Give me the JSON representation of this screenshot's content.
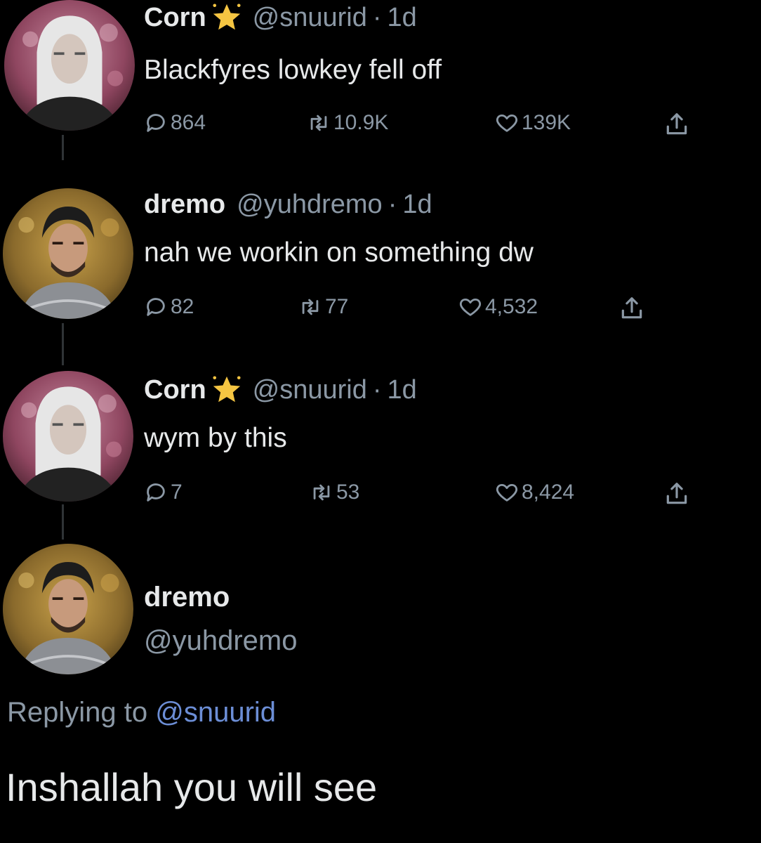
{
  "tweets": [
    {
      "display_name": "Corn",
      "handle": "@snuurid",
      "separator": "·",
      "time": "1d",
      "text": "Blackfyres lowkey fell off",
      "replies": "864",
      "retweets": "10.9K",
      "likes": "139K"
    },
    {
      "display_name": "dremo",
      "handle": "@yuhdremo",
      "separator": "·",
      "time": "1d",
      "text": "nah we workin on something dw",
      "replies": "82",
      "retweets": "77",
      "likes": "4,532"
    },
    {
      "display_name": "Corn",
      "handle": "@snuurid",
      "separator": "·",
      "time": "1d",
      "text": "wym by this",
      "replies": "7",
      "retweets": "53",
      "likes": "8,424"
    }
  ],
  "final_tweet": {
    "display_name": "dremo",
    "handle": "@yuhdremo",
    "replying_prefix": "Replying to",
    "replying_to": "@snuurid",
    "text": "Inshallah you will see"
  },
  "icons": {
    "reply": "reply-icon",
    "retweet": "retweet-icon",
    "like": "heart-icon",
    "share": "share-icon",
    "verified": "star-badge-icon"
  },
  "colors": {
    "background": "#000000",
    "text": "#e7e9ea",
    "muted": "#8b98a5",
    "mention": "#6c8ed6",
    "badge": "#f5c542"
  }
}
